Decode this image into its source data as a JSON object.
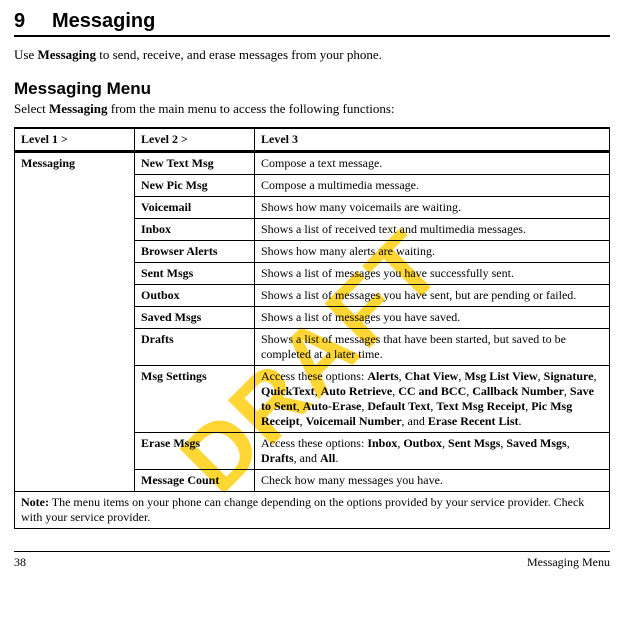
{
  "watermark": "DRAFT",
  "chapter": {
    "number": "9",
    "title": "Messaging"
  },
  "intro": {
    "pre": "Use ",
    "bold": "Messaging",
    "post": " to send, receive, and erase messages from your phone."
  },
  "section": {
    "heading": "Messaging Menu",
    "text_pre": "Select ",
    "text_bold": "Messaging",
    "text_post": " from the main menu to access the following functions:"
  },
  "table": {
    "headers": [
      "Level 1 >",
      "Level 2 >",
      "Level 3"
    ],
    "rowspan_label": "Messaging",
    "rows": [
      {
        "l2": "New Text Msg",
        "l3": "Compose a text message."
      },
      {
        "l2": "New Pic Msg",
        "l3": "Compose a multimedia message."
      },
      {
        "l2": "Voicemail",
        "l3": "Shows how many voicemails are waiting."
      },
      {
        "l2": "Inbox",
        "l3": "Shows a list of received text and multimedia messages."
      },
      {
        "l2": "Browser Alerts",
        "l3": "Shows how many alerts are waiting."
      },
      {
        "l2": "Sent Msgs",
        "l3": "Shows a list of messages you have successfully sent."
      },
      {
        "l2": "Outbox",
        "l3": "Shows a list of messages you have sent, but are pending or failed."
      },
      {
        "l2": "Saved Msgs",
        "l3": "Shows a list of messages you have saved."
      },
      {
        "l2": "Drafts",
        "l3": "Shows a list of messages that have been started, but saved to be completed at a later time."
      }
    ],
    "msg_settings": {
      "l2": "Msg Settings",
      "l3_pre": "Access these options: ",
      "opts": [
        "Alerts",
        "Chat View",
        "Msg List View",
        "Signature",
        "QuickText",
        "Auto Retrieve",
        "CC and BCC",
        "Callback Number",
        "Save to Sent",
        "Auto-Erase",
        "Default Text",
        "Text Msg Receipt",
        "Pic Msg Receipt",
        "Voicemail Number"
      ],
      "l3_and": ", and ",
      "l3_last": "Erase Recent List",
      "l3_end": "."
    },
    "erase_msgs": {
      "l2": "Erase Msgs",
      "l3_pre": "Access these options: ",
      "opts": [
        "Inbox",
        "Outbox",
        "Sent Msgs",
        "Saved Msgs",
        "Drafts"
      ],
      "l3_and": ", and ",
      "l3_last": "All",
      "l3_end": "."
    },
    "last_row": {
      "l2": "Message Count",
      "l3": "Check how many messages you have."
    },
    "note_bold": "Note:",
    "note_text": " The menu items on your phone can change depending on the options provided by your service provider. Check with your service provider."
  },
  "footer": {
    "left": "38",
    "right": "Messaging Menu"
  }
}
